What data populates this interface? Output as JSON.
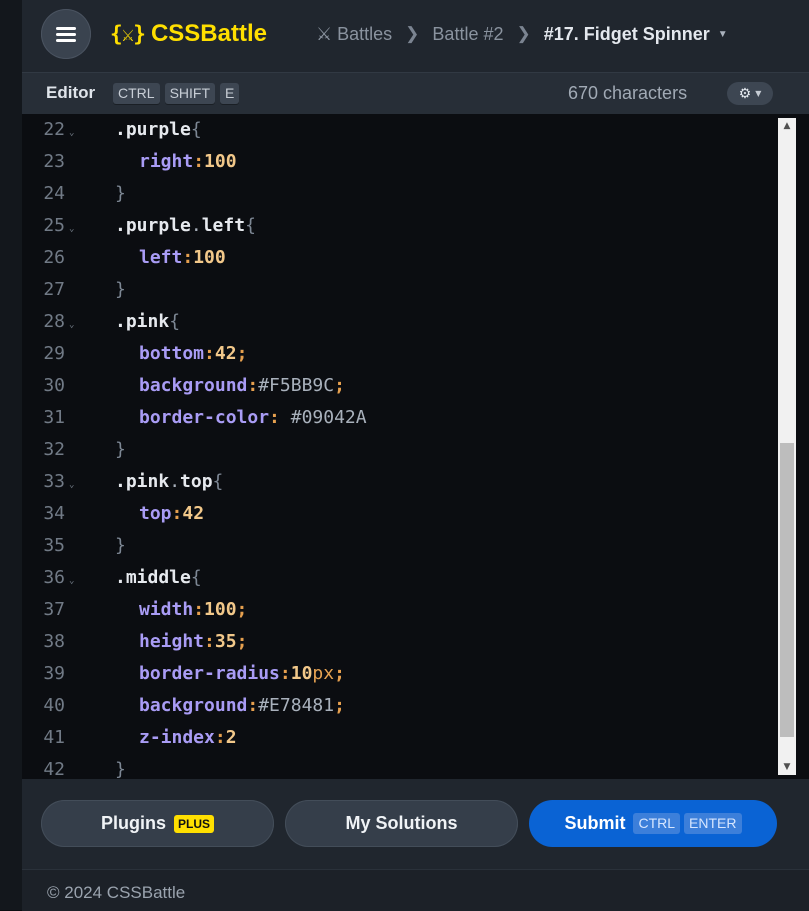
{
  "header": {
    "logo_mark": "{⚔}",
    "logo_text": "CSSBattle",
    "breadcrumbs": [
      "Battles",
      "Battle #2",
      "#17. Fidget Spinner"
    ]
  },
  "editor_bar": {
    "title": "Editor",
    "shortcut_keys": [
      "CTRL",
      "SHIFT",
      "E"
    ],
    "character_count": "670 characters"
  },
  "code_lines": [
    {
      "num": "22",
      "fold": true,
      "tokens": [
        [
          ".purple",
          "sel"
        ],
        [
          "{",
          "brace"
        ]
      ]
    },
    {
      "num": "23",
      "fold": false,
      "tokens": [
        [
          "right",
          "prop"
        ],
        [
          ":",
          "punct"
        ],
        [
          "100",
          "num"
        ]
      ]
    },
    {
      "num": "24",
      "fold": false,
      "tokens": [
        [
          "}",
          "brace"
        ]
      ]
    },
    {
      "num": "25",
      "fold": true,
      "tokens": [
        [
          ".purple",
          "sel"
        ],
        [
          ".",
          "dot"
        ],
        [
          "left",
          "sel"
        ],
        [
          "{",
          "brace"
        ]
      ]
    },
    {
      "num": "26",
      "fold": false,
      "tokens": [
        [
          "left",
          "prop"
        ],
        [
          ":",
          "punct"
        ],
        [
          "100",
          "num"
        ]
      ]
    },
    {
      "num": "27",
      "fold": false,
      "tokens": [
        [
          "}",
          "brace"
        ]
      ]
    },
    {
      "num": "28",
      "fold": true,
      "tokens": [
        [
          ".pink",
          "sel"
        ],
        [
          "{",
          "brace"
        ]
      ]
    },
    {
      "num": "29",
      "fold": false,
      "tokens": [
        [
          "bottom",
          "prop"
        ],
        [
          ":",
          "punct"
        ],
        [
          "42",
          "num"
        ],
        [
          ";",
          "punct"
        ]
      ]
    },
    {
      "num": "30",
      "fold": false,
      "tokens": [
        [
          "background",
          "prop"
        ],
        [
          ":",
          "punct"
        ],
        [
          "#F5BB9C",
          "hex"
        ],
        [
          ";",
          "punct"
        ]
      ]
    },
    {
      "num": "31",
      "fold": false,
      "tokens": [
        [
          "border-color",
          "prop"
        ],
        [
          ": ",
          "punct"
        ],
        [
          "#09042A",
          "hex"
        ]
      ]
    },
    {
      "num": "32",
      "fold": false,
      "tokens": [
        [
          "}",
          "brace"
        ]
      ]
    },
    {
      "num": "33",
      "fold": true,
      "tokens": [
        [
          ".pink",
          "sel"
        ],
        [
          ".",
          "dot"
        ],
        [
          "top",
          "sel"
        ],
        [
          "{",
          "brace"
        ]
      ]
    },
    {
      "num": "34",
      "fold": false,
      "tokens": [
        [
          "top",
          "prop"
        ],
        [
          ":",
          "punct"
        ],
        [
          "42",
          "num"
        ]
      ]
    },
    {
      "num": "35",
      "fold": false,
      "tokens": [
        [
          "}",
          "brace"
        ]
      ]
    },
    {
      "num": "36",
      "fold": true,
      "tokens": [
        [
          ".middle",
          "sel"
        ],
        [
          "{",
          "brace"
        ]
      ]
    },
    {
      "num": "37",
      "fold": false,
      "tokens": [
        [
          "width",
          "prop"
        ],
        [
          ":",
          "punct"
        ],
        [
          "100",
          "num"
        ],
        [
          ";",
          "punct"
        ]
      ]
    },
    {
      "num": "38",
      "fold": false,
      "tokens": [
        [
          "height",
          "prop"
        ],
        [
          ":",
          "punct"
        ],
        [
          "35",
          "num"
        ],
        [
          ";",
          "punct"
        ]
      ]
    },
    {
      "num": "39",
      "fold": false,
      "tokens": [
        [
          "border-radius",
          "prop"
        ],
        [
          ":",
          "punct"
        ],
        [
          "10",
          "num"
        ],
        [
          "px",
          "unit"
        ],
        [
          ";",
          "punct"
        ]
      ]
    },
    {
      "num": "40",
      "fold": false,
      "tokens": [
        [
          "background",
          "prop"
        ],
        [
          ":",
          "punct"
        ],
        [
          "#E78481",
          "hex"
        ],
        [
          ";",
          "punct"
        ]
      ]
    },
    {
      "num": "41",
      "fold": false,
      "tokens": [
        [
          "z-index",
          "prop"
        ],
        [
          ":",
          "punct"
        ],
        [
          "2",
          "num"
        ]
      ]
    },
    {
      "num": "42",
      "fold": false,
      "tokens": [
        [
          "}",
          "brace"
        ]
      ]
    }
  ],
  "buttons": {
    "plugins": "Plugins",
    "plugins_badge": "PLUS",
    "my_solutions": "My Solutions",
    "submit": "Submit",
    "submit_keys": [
      "CTRL",
      "ENTER"
    ]
  },
  "footer": {
    "copyright": "© 2024 CSSBattle"
  },
  "colors": {
    "brand_yellow": "#ffdf00",
    "submit_blue": "#0a63d4",
    "property_purple": "#a99cf5",
    "number_orange": "#f2c88a"
  },
  "icons": [
    "menu-icon",
    "crossed-swords-icon",
    "chevron-right-icon",
    "caret-down-icon",
    "gear-icon",
    "fold-chevron-icon"
  ]
}
